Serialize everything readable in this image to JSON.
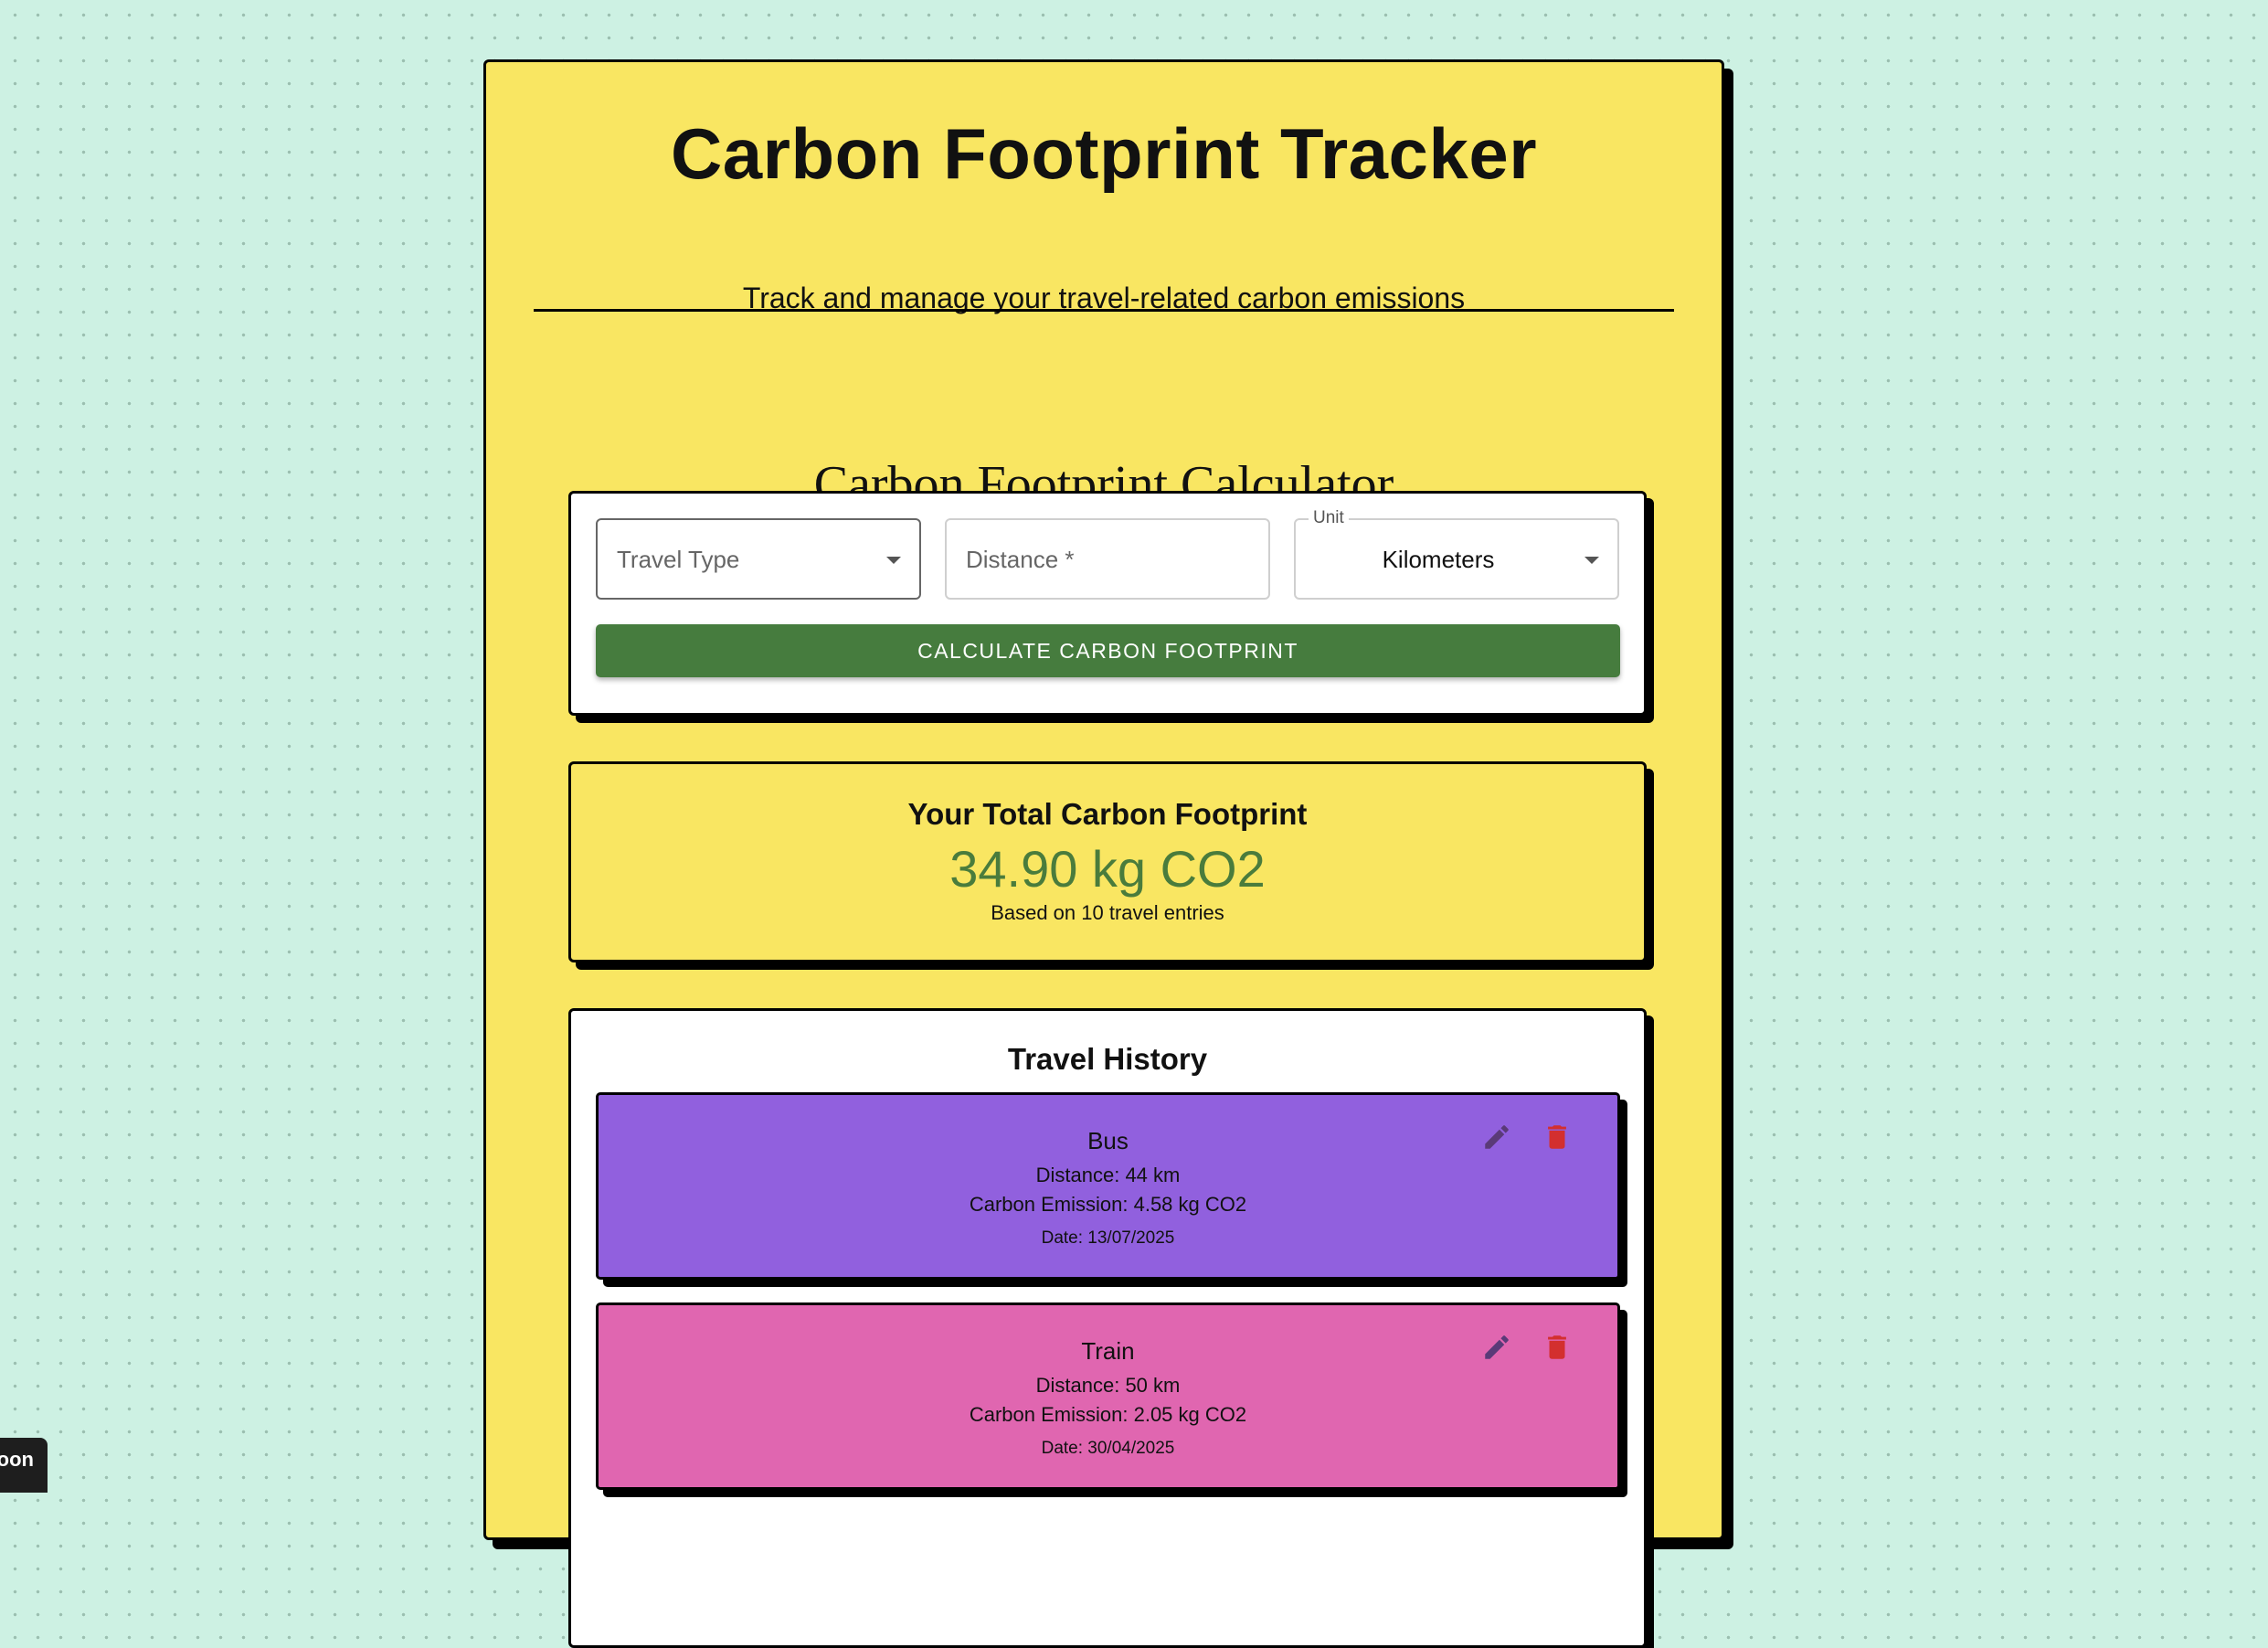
{
  "header": {
    "title": "Carbon Footprint Tracker",
    "subtitle": "Track and manage your travel-related carbon emissions"
  },
  "calculator": {
    "heading": "Carbon Footprint Calculator",
    "travel_type": {
      "placeholder": "Travel Type",
      "value": ""
    },
    "distance": {
      "placeholder": "Distance *",
      "value": ""
    },
    "unit": {
      "label": "Unit",
      "value": "Kilometers"
    },
    "button_label": "CALCULATE CARBON FOOTPRINT"
  },
  "summary": {
    "heading": "Your Total Carbon Footprint",
    "total": "34.90 kg CO2",
    "note": "Based on 10 travel entries"
  },
  "history": {
    "title": "Travel History",
    "entries": [
      {
        "type": "Bus",
        "distance": "Distance: 44 km",
        "emission": "Carbon Emission: 4.58 kg CO2",
        "date": "Date: 13/07/2025",
        "color": "#9160de"
      },
      {
        "type": "Train",
        "distance": "Distance: 50 km",
        "emission": "Carbon Emission: 2.05 kg CO2",
        "date": "Date: 30/04/2025",
        "color": "#e066b0"
      }
    ]
  },
  "icons": {
    "edit": "pencil-icon",
    "delete": "trash-icon",
    "edit_color": "#5a3a78",
    "delete_color": "#d32f2f"
  },
  "corner_tab": {
    "text": "oon"
  },
  "colors": {
    "background": "#cdf1e3",
    "card": "#f9e662",
    "button": "#467c3e",
    "total_value": "#4a7c3c"
  }
}
